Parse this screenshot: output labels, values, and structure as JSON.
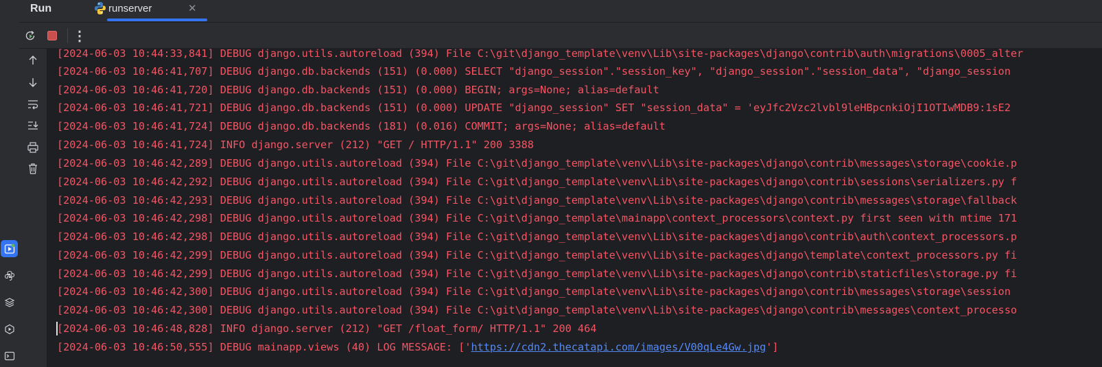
{
  "tool_strip": {
    "buttons": [
      {
        "icon": "run-icon",
        "active": true
      },
      {
        "icon": "python-console-icon",
        "active": false
      },
      {
        "icon": "layers-icon",
        "active": false
      },
      {
        "icon": "services-icon",
        "active": false
      },
      {
        "icon": "terminal-icon",
        "active": false
      }
    ]
  },
  "tabbar": {
    "title": "Run",
    "tab": {
      "label": "runserver",
      "icon": "python-icon",
      "close": "✕"
    }
  },
  "toolbar": {
    "buttons": [
      "rerun-icon",
      "stop-icon",
      "more-icon"
    ],
    "more_glyph": "⋮"
  },
  "gutter": {
    "buttons": [
      "scroll-up-icon",
      "scroll-down-icon",
      "soft-wrap-icon",
      "scroll-to-end-icon",
      "print-icon",
      "clear-all-icon"
    ]
  },
  "console": {
    "lines": [
      "[2024-06-03 10:44:33,841] DEBUG django.utils.autoreload (394) File C:\\git\\django_template\\venv\\Lib\\site-packages\\django\\contrib\\auth\\migrations\\0005_alter",
      "[2024-06-03 10:46:41,707] DEBUG django.db.backends (151) (0.000) SELECT \"django_session\".\"session_key\", \"django_session\".\"session_data\", \"django_session",
      "[2024-06-03 10:46:41,720] DEBUG django.db.backends (151) (0.000) BEGIN; args=None; alias=default",
      "[2024-06-03 10:46:41,721] DEBUG django.db.backends (151) (0.000) UPDATE \"django_session\" SET \"session_data\" = 'eyJfc2Vzc2lvbl9leHBpcnkiOjI1OTIwMDB9:1sE2",
      "[2024-06-03 10:46:41,724] DEBUG django.db.backends (181) (0.016) COMMIT; args=None; alias=default",
      "[2024-06-03 10:46:41,724] INFO django.server (212) \"GET / HTTP/1.1\" 200 3388",
      "[2024-06-03 10:46:42,289] DEBUG django.utils.autoreload (394) File C:\\git\\django_template\\venv\\Lib\\site-packages\\django\\contrib\\messages\\storage\\cookie.p",
      "[2024-06-03 10:46:42,292] DEBUG django.utils.autoreload (394) File C:\\git\\django_template\\venv\\Lib\\site-packages\\django\\contrib\\sessions\\serializers.py f",
      "[2024-06-03 10:46:42,293] DEBUG django.utils.autoreload (394) File C:\\git\\django_template\\venv\\Lib\\site-packages\\django\\contrib\\messages\\storage\\fallback",
      "[2024-06-03 10:46:42,298] DEBUG django.utils.autoreload (394) File C:\\git\\django_template\\mainapp\\context_processors\\context.py first seen with mtime 171",
      "[2024-06-03 10:46:42,298] DEBUG django.utils.autoreload (394) File C:\\git\\django_template\\venv\\Lib\\site-packages\\django\\contrib\\auth\\context_processors.p",
      "[2024-06-03 10:46:42,299] DEBUG django.utils.autoreload (394) File C:\\git\\django_template\\venv\\Lib\\site-packages\\django\\template\\context_processors.py fi",
      "[2024-06-03 10:46:42,299] DEBUG django.utils.autoreload (394) File C:\\git\\django_template\\venv\\Lib\\site-packages\\django\\contrib\\staticfiles\\storage.py fi",
      "[2024-06-03 10:46:42,300] DEBUG django.utils.autoreload (394) File C:\\git\\django_template\\venv\\Lib\\site-packages\\django\\contrib\\messages\\storage\\session",
      "[2024-06-03 10:46:42,300] DEBUG django.utils.autoreload (394) File C:\\git\\django_template\\venv\\Lib\\site-packages\\django\\contrib\\messages\\context_processo",
      "[2024-06-03 10:46:48,828] INFO django.server (212) \"GET /float_form/ HTTP/1.1\" 200 464"
    ],
    "last_line": {
      "prefix": "[2024-06-03 10:46:50,555] DEBUG mainapp.views (40) LOG MESSAGE: ['",
      "link": "https://cdn2.thecatapi.com/images/V00qLe4Gw.jpg",
      "suffix": "']"
    }
  },
  "colors": {
    "log_text": "#f75464",
    "link": "#548af7",
    "accent": "#3574f0",
    "background": "#1e1f22",
    "panel": "#2b2d30"
  }
}
